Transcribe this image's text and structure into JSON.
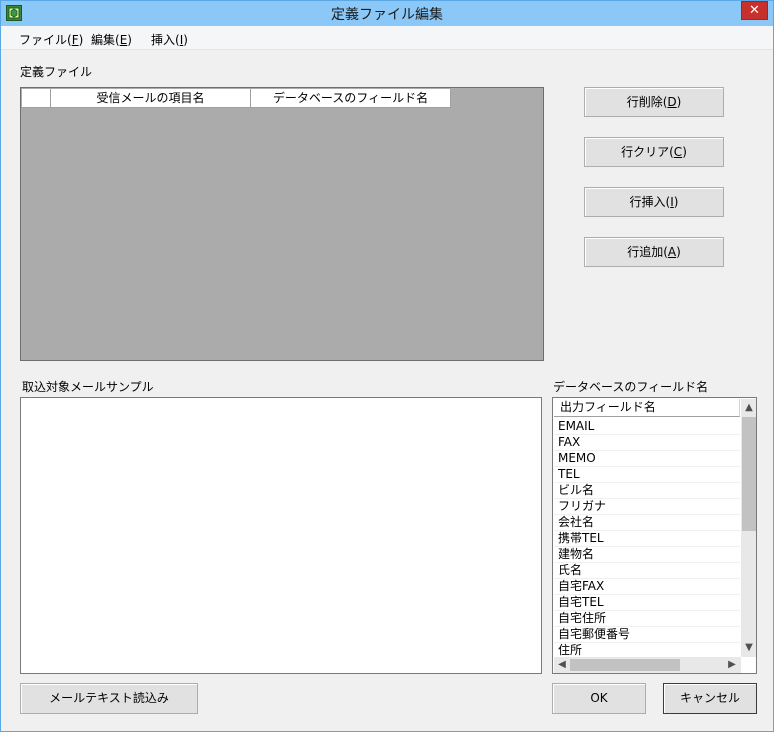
{
  "window": {
    "title": "定義ファイル編集",
    "close_label": "✕"
  },
  "menu": [
    {
      "label": "ファイル(",
      "key": "F",
      "end": ")"
    },
    {
      "label": "編集(",
      "key": "E",
      "end": ")"
    },
    {
      "label": "挿入(",
      "key": "I",
      "end": ")"
    }
  ],
  "definition": {
    "label": "定義ファイル",
    "columns": [
      "受信メールの項目名",
      "データベースのフィールド名"
    ]
  },
  "buttons": {
    "delete_row": {
      "label": "行削除(",
      "key": "D",
      "end": ")"
    },
    "clear_row": {
      "label": "行クリア(",
      "key": "C",
      "end": ")"
    },
    "insert_row": {
      "label": "行挿入(",
      "key": "I",
      "end": ")"
    },
    "add_row": {
      "label": "行追加(",
      "key": "A",
      "end": ")"
    },
    "read_mail_text": "メールテキスト読込み",
    "ok": "OK",
    "cancel": "キャンセル"
  },
  "sample": {
    "label": "取込対象メールサンプル"
  },
  "fields": {
    "label": "データベースのフィールド名",
    "header": "出力フィールド名",
    "items": [
      "EMAIL",
      "FAX",
      "MEMO",
      "TEL",
      "ビル名",
      "フリガナ",
      "会社名",
      "携帯TEL",
      "建物名",
      "氏名",
      "自宅FAX",
      "自宅TEL",
      "自宅住所",
      "自宅郵便番号",
      "住所"
    ]
  },
  "colors": {
    "titlebar": "#8cc8f7",
    "close": "#c7302b",
    "grid_bg": "#ababab"
  }
}
